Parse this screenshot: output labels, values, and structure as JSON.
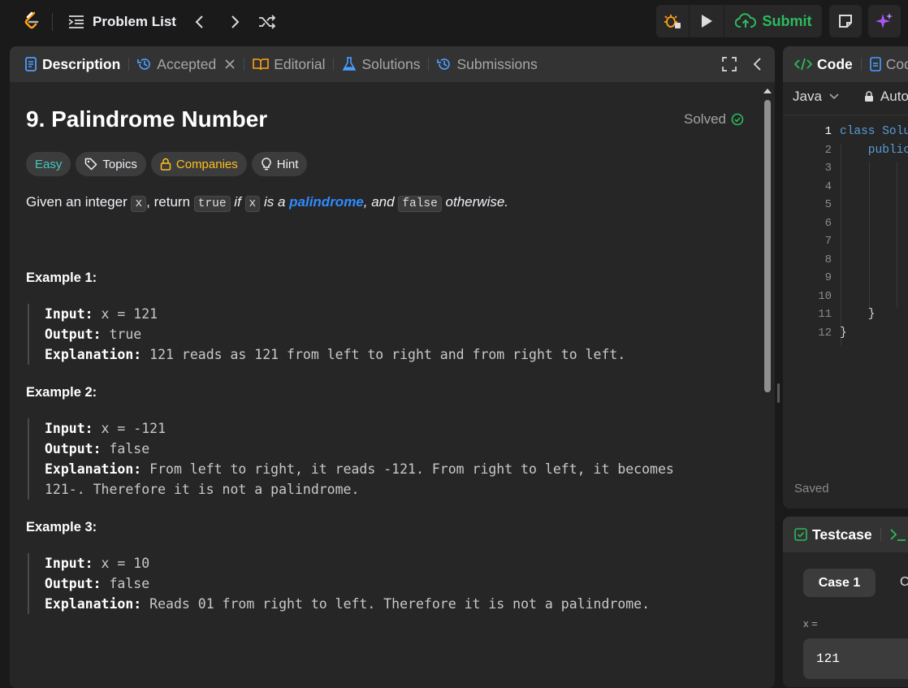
{
  "topbar": {
    "problem_list": "Problem List",
    "submit": "Submit"
  },
  "left_panel": {
    "tabs": [
      "Description",
      "Accepted",
      "Editorial",
      "Solutions",
      "Submissions"
    ],
    "title": "9. Palindrome Number",
    "status": "Solved",
    "chips": {
      "difficulty": "Easy",
      "topics": "Topics",
      "companies": "Companies",
      "hint": "Hint"
    },
    "description": {
      "p1": "Given an integer ",
      "c1": "x",
      "p2": ", return ",
      "c2": "true",
      "p3": " if ",
      "c3": "x",
      "p4": " is a ",
      "link": "palindrome",
      "p5": ", and ",
      "c4": "false",
      "p6": " otherwise."
    },
    "examples": [
      {
        "heading": "Example 1:",
        "input_label": "Input:",
        "input": " x = 121",
        "output_label": "Output:",
        "output": " true",
        "expl_label": "Explanation:",
        "expl": " 121 reads as 121 from left to right and from right to left."
      },
      {
        "heading": "Example 2:",
        "input_label": "Input:",
        "input": " x = -121",
        "output_label": "Output:",
        "output": " false",
        "expl_label": "Explanation:",
        "expl": " From left to right, it reads -121. From right to left, it becomes",
        "expl2": "121-. Therefore it is not a palindrome."
      },
      {
        "heading": "Example 3:",
        "input_label": "Input:",
        "input": " x = 10",
        "output_label": "Output:",
        "output": " false",
        "expl_label": "Explanation:",
        "expl": " Reads 01 from right to left. Therefore it is not a palindrome."
      }
    ]
  },
  "editor": {
    "tab_code": "Code",
    "tab_cod2": "Cod",
    "language": "Java",
    "auto": "Auto",
    "line_numbers": [
      "1",
      "2",
      "3",
      "4",
      "5",
      "6",
      "7",
      "8",
      "9",
      "10",
      "11",
      "12"
    ],
    "code_lines": [
      "class Solu",
      "    public",
      "",
      "",
      "",
      "",
      "",
      "",
      "",
      "",
      "    }",
      "}"
    ],
    "saved": "Saved"
  },
  "testcase": {
    "tab": "Testcase",
    "case1": "Case 1",
    "case2": "C",
    "var_label": "x =",
    "value": "121"
  },
  "colors": {
    "accent_green": "#2cbb5d",
    "easy": "#46c6c2",
    "companies": "#ffc01e",
    "link": "#2f8bff",
    "bg": "#1a1a1a",
    "panel": "#262626"
  }
}
